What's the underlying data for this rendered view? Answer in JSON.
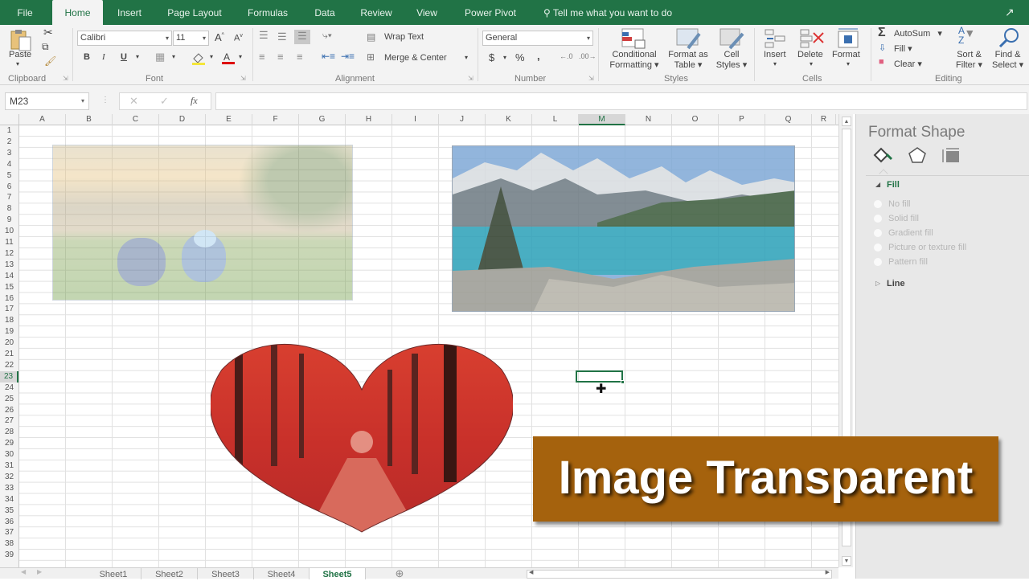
{
  "tabs": [
    {
      "label": "File",
      "active": false
    },
    {
      "label": "Home",
      "active": true
    },
    {
      "label": "Insert",
      "active": false
    },
    {
      "label": "Page Layout",
      "active": false
    },
    {
      "label": "Formulas",
      "active": false
    },
    {
      "label": "Data",
      "active": false
    },
    {
      "label": "Review",
      "active": false
    },
    {
      "label": "View",
      "active": false
    },
    {
      "label": "Power Pivot",
      "active": false
    }
  ],
  "tell_me": "Tell me what you want to do",
  "ribbon": {
    "clipboard": {
      "label": "Clipboard",
      "paste": "Paste"
    },
    "font": {
      "label": "Font",
      "font_name": "Calibri",
      "font_size": "11",
      "bold": "B",
      "italic": "I",
      "underline": "U",
      "grow": "A",
      "shrink": "A"
    },
    "alignment": {
      "label": "Alignment",
      "wrap_text": "Wrap Text",
      "merge_center": "Merge & Center"
    },
    "number": {
      "label": "Number",
      "format": "General",
      "currency": "$",
      "percent": "%",
      "comma": ","
    },
    "styles": {
      "label": "Styles",
      "conditional_1": "Conditional",
      "conditional_2": "Formatting",
      "format_table_1": "Format as",
      "format_table_2": "Table",
      "cell_styles_1": "Cell",
      "cell_styles_2": "Styles"
    },
    "cells": {
      "label": "Cells",
      "insert": "Insert",
      "delete": "Delete",
      "format": "Format"
    },
    "editing": {
      "label": "Editing",
      "autosum": "AutoSum",
      "fill": "Fill",
      "clear": "Clear",
      "sort_1": "Sort &",
      "sort_2": "Filter",
      "find_1": "Find &",
      "find_2": "Select"
    }
  },
  "formula_bar": {
    "name_box": "M23",
    "fx": "fx",
    "value": ""
  },
  "columns": [
    "A",
    "B",
    "C",
    "D",
    "E",
    "F",
    "G",
    "H",
    "I",
    "J",
    "K",
    "L",
    "M",
    "N",
    "O",
    "P",
    "Q",
    "R"
  ],
  "selected_column": "M",
  "rows": [
    "1",
    "2",
    "3",
    "4",
    "5",
    "6",
    "7",
    "8",
    "9",
    "10",
    "11",
    "12",
    "13",
    "14",
    "15",
    "16",
    "17",
    "18",
    "19",
    "20",
    "21",
    "22",
    "23",
    "24",
    "25",
    "26",
    "27",
    "28",
    "29",
    "30",
    "31",
    "32",
    "33",
    "34",
    "35",
    "36",
    "37",
    "38",
    "39"
  ],
  "selected_row": "23",
  "format_pane": {
    "title": "Format Shape",
    "fill_section": "Fill",
    "fill_options": [
      "No fill",
      "Solid fill",
      "Gradient fill",
      "Picture or texture fill",
      "Pattern fill"
    ],
    "line_section": "Line"
  },
  "sheets": [
    {
      "label": "Sheet1",
      "active": false
    },
    {
      "label": "Sheet2",
      "active": false
    },
    {
      "label": "Sheet3",
      "active": false
    },
    {
      "label": "Sheet4",
      "active": false
    },
    {
      "label": "Sheet5",
      "active": true
    }
  ],
  "images": {
    "faded_photo": {
      "subject": "children in grass at sunset",
      "transparency_note": "faded"
    },
    "lake_photo": {
      "subject": "mountain lake"
    },
    "heart_photo": {
      "subject": "red autumn forest path",
      "shape": "heart"
    }
  },
  "banner": {
    "text": "Image Transparent",
    "color": "#a5620d"
  },
  "colors": {
    "accent": "#217346"
  }
}
